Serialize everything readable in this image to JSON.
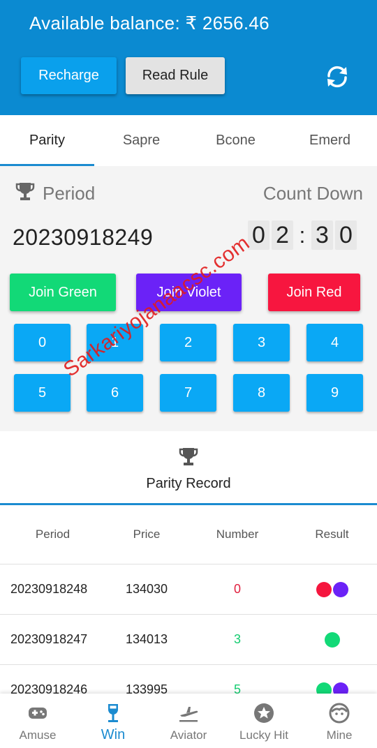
{
  "header": {
    "balance_text": "Available balance: ₹ 2656.46",
    "recharge_label": "Recharge",
    "read_rule_label": "Read Rule",
    "refresh_icon": "refresh-icon",
    "bg_color": "#0b8ad1"
  },
  "tabs": [
    {
      "label": "Parity",
      "active": true
    },
    {
      "label": "Sapre",
      "active": false
    },
    {
      "label": "Bcone",
      "active": false
    },
    {
      "label": "Emerd",
      "active": false
    }
  ],
  "game": {
    "period_label": "Period",
    "countdown_label": "Count Down",
    "period_value": "20230918249",
    "timer": [
      "0",
      "2",
      ":",
      "3",
      "0"
    ],
    "join_green": "Join Green",
    "join_violet": "Join Violet",
    "join_red": "Join Red",
    "numbers": [
      "0",
      "1",
      "2",
      "3",
      "4",
      "5",
      "6",
      "7",
      "8",
      "9"
    ]
  },
  "record": {
    "title": "Parity Record",
    "headers": [
      "Period",
      "Price",
      "Number",
      "Result"
    ],
    "rows": [
      {
        "period": "20230918248",
        "price": "134030",
        "number": "0",
        "number_color": "#e0203f",
        "result": [
          "#f5163e",
          "#6b22f7"
        ]
      },
      {
        "period": "20230918247",
        "price": "134013",
        "number": "3",
        "number_color": "#14cc70",
        "result": [
          "#12d977"
        ]
      },
      {
        "period": "20230918246",
        "price": "133995",
        "number": "5",
        "number_color": "#14cc70",
        "result": [
          "#12d977",
          "#6b22f7"
        ]
      }
    ]
  },
  "watermark": "Sarkariyojanaacsc.com",
  "nav": [
    {
      "label": "Amuse",
      "icon": "gamepad-icon",
      "active": false
    },
    {
      "label": "Win",
      "icon": "wine-glass-icon",
      "active": true
    },
    {
      "label": "Aviator",
      "icon": "airplane-icon",
      "active": false
    },
    {
      "label": "Lucky Hit",
      "icon": "star-icon",
      "active": false
    },
    {
      "label": "Mine",
      "icon": "face-icon",
      "active": false
    }
  ]
}
